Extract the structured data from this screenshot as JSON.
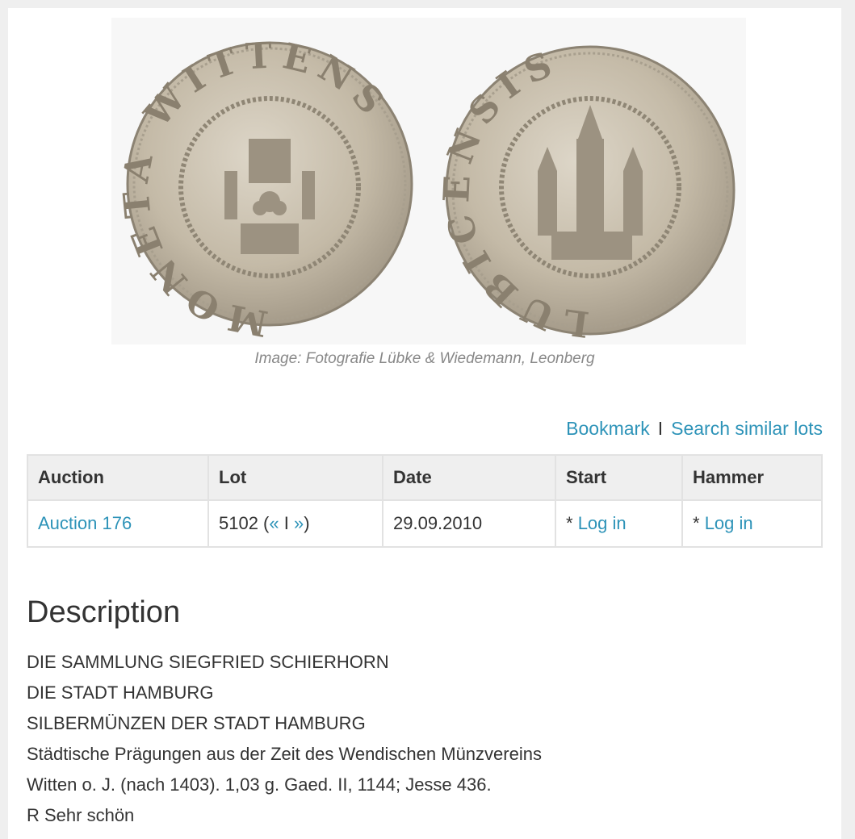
{
  "image": {
    "caption": "Image: Fotografie Lübke & Wiedemann, Leonberg",
    "obverse_legend": "MONETA WITTENS",
    "reverse_legend": "LUBICENSIS"
  },
  "actions": {
    "bookmark": "Bookmark",
    "separator": "I",
    "search_similar": "Search similar lots"
  },
  "table": {
    "headers": [
      "Auction",
      "Lot",
      "Date",
      "Start",
      "Hammer"
    ],
    "row": {
      "auction": "Auction 176",
      "lot_number": "5102 (",
      "prev": "«",
      "divider": " I ",
      "next": "»",
      "lot_close": ")",
      "date": "29.09.2010",
      "start_prefix": "* ",
      "start_link": "Log in",
      "hammer_prefix": "* ",
      "hammer_link": "Log in"
    }
  },
  "description": {
    "title": "Description",
    "lines": [
      "DIE SAMMLUNG SIEGFRIED SCHIERHORN",
      "DIE STADT HAMBURG",
      "SILBERMÜNZEN DER STADT HAMBURG",
      "Städtische Prägungen aus der Zeit des Wendischen Münzvereins",
      "Witten o. J. (nach 1403). 1,03 g. Gaed. II, 1144; Jesse 436.",
      "R Sehr schön"
    ]
  },
  "colors": {
    "link": "#2d93b8",
    "header_bg": "#efefef",
    "coin_silver": "#c9bfad"
  }
}
